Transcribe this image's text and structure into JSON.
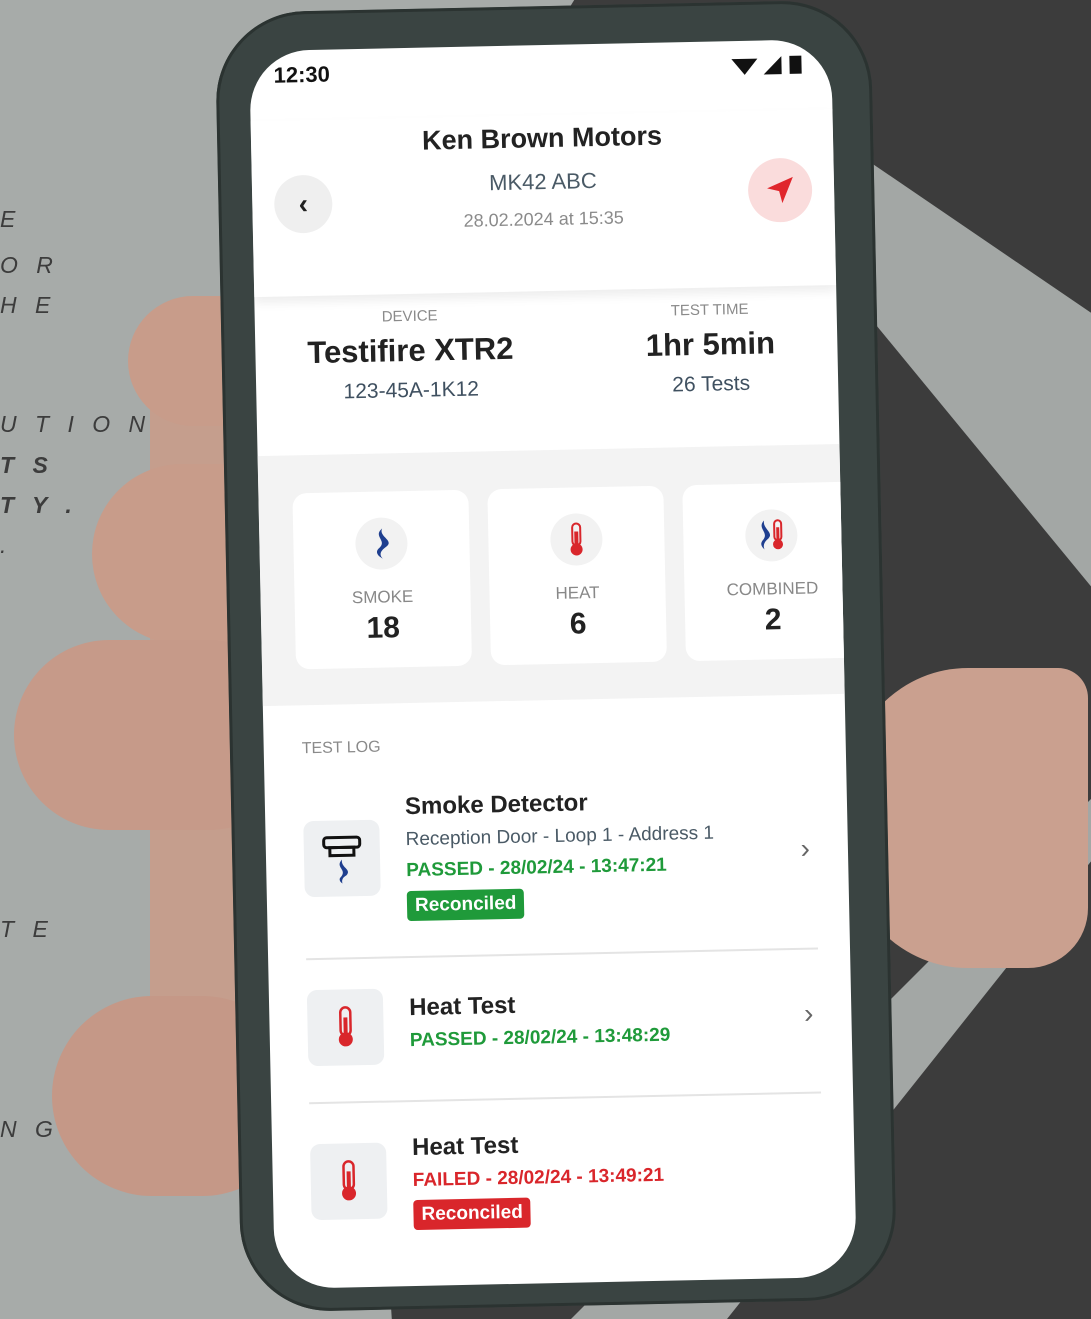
{
  "colors": {
    "passed": "#1f9a3a",
    "failed": "#d9262b",
    "accent_red": "#e0262c",
    "smoke_blue": "#1f3f8f"
  },
  "side_text": [
    "E",
    "O R",
    "H E",
    "U T I O N",
    "T S",
    "T Y .",
    ".",
    "T E",
    "N G"
  ],
  "status_bar": {
    "time": "12:30",
    "icons": "wifi-icon signal-icon battery-icon"
  },
  "header": {
    "title": "Ken Brown Motors",
    "subtitle": "MK42 ABC",
    "date": "28.02.2024 at 15:35"
  },
  "device": {
    "label": "DEVICE",
    "name": "Testifire XTR2",
    "serial": "123-45A-1K12"
  },
  "test_time": {
    "label": "TEST TIME",
    "duration": "1hr 5min",
    "count": "26 Tests"
  },
  "cards": [
    {
      "label": "SMOKE",
      "value": "18",
      "icon": "smoke-icon"
    },
    {
      "label": "HEAT",
      "value": "6",
      "icon": "thermometer-icon"
    },
    {
      "label": "COMBINED",
      "value": "2",
      "icon": "combined-icon"
    }
  ],
  "test_log": {
    "label": "TEST LOG",
    "items": [
      {
        "title": "Smoke Detector",
        "location": "Reception Door  -  Loop 1 - Address 1",
        "status": "PASSED - 28/02/24 - 13:47:21",
        "badge": "Reconciled",
        "result": "passed"
      },
      {
        "title": "Heat Test",
        "status": "PASSED - 28/02/24 - 13:48:29",
        "result": "passed"
      },
      {
        "title": "Heat Test",
        "status": "FAILED - 28/02/24 - 13:49:21",
        "badge": "Reconciled",
        "result": "failed"
      }
    ]
  }
}
